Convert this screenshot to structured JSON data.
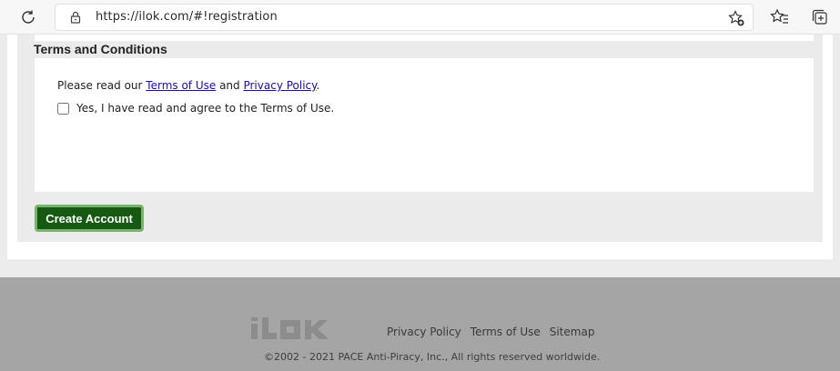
{
  "browser": {
    "url": "https://ilok.com/#!registration",
    "icons": [
      "refresh-icon",
      "lock-icon",
      "add-favorite-icon",
      "favorites-icon",
      "collections-icon"
    ]
  },
  "terms": {
    "title": "Terms and Conditions",
    "read_prefix": "Please read our ",
    "terms_link": "Terms of Use",
    "and": " and ",
    "privacy_link": "Privacy Policy",
    "period": ".",
    "agree_label": "Yes, I have read and agree to the Terms of Use.",
    "agree_checked": false
  },
  "actions": {
    "create_account": "Create Account"
  },
  "footer": {
    "logo": "iLOK",
    "links": [
      "Privacy Policy",
      "Terms of Use",
      "Sitemap"
    ],
    "copyright": "©2002 - 2021 PACE Anti-Piracy, Inc., All rights reserved worldwide."
  },
  "colors": {
    "primary_button": "#165a12",
    "button_border": "#78b470",
    "link": "#1a0dab",
    "footer_bg": "#a5a5a5"
  }
}
